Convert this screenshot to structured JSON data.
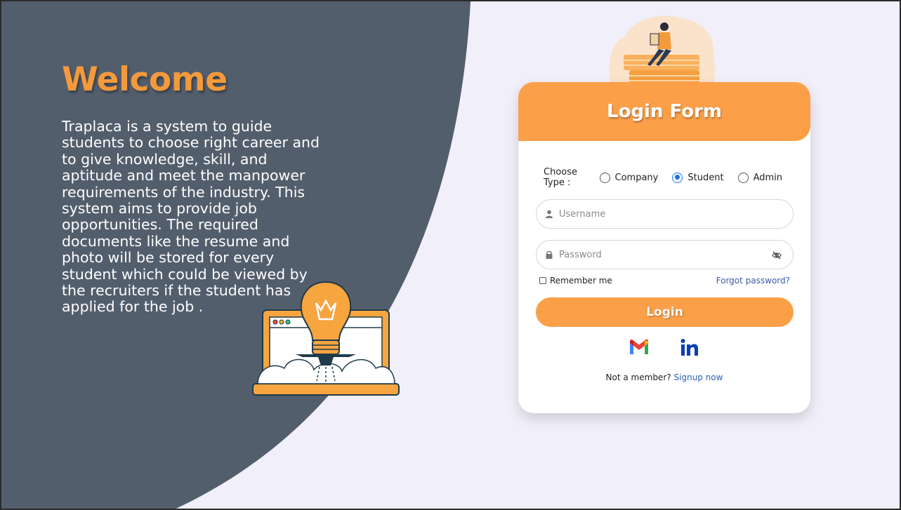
{
  "left": {
    "welcome": "Welcome",
    "about": "Traplaca is a system to guide students to choose right career and to give knowledge, skill, and aptitude and meet the manpower requirements of the industry. This system aims to provide job opportunities. The required documents like the resume and photo will be stored for every student which could be viewed by the recruiters if the student has applied for the job ."
  },
  "form": {
    "title": "Login Form",
    "choose_type_label": "Choose Type :",
    "types": [
      {
        "label": "Company",
        "selected": false
      },
      {
        "label": "Student",
        "selected": true
      },
      {
        "label": "Admin",
        "selected": false
      }
    ],
    "username_placeholder": "Username",
    "password_placeholder": "Password",
    "remember_label": "Remember me",
    "forgot_label": "Forgot password?",
    "login_label": "Login",
    "not_member_text": "Not a member?",
    "signup_label": "Signup now"
  },
  "icons": {
    "user": "user-icon",
    "lock": "lock-icon",
    "eye": "eye-slash-icon",
    "gmail": "gmail-icon",
    "linkedin": "linkedin-icon"
  },
  "colors": {
    "accent": "#fb9f48",
    "dark_panel": "#535e6d",
    "background": "#f1eff9",
    "link": "#2f5fb0",
    "radio_selected": "#1a73e8"
  }
}
